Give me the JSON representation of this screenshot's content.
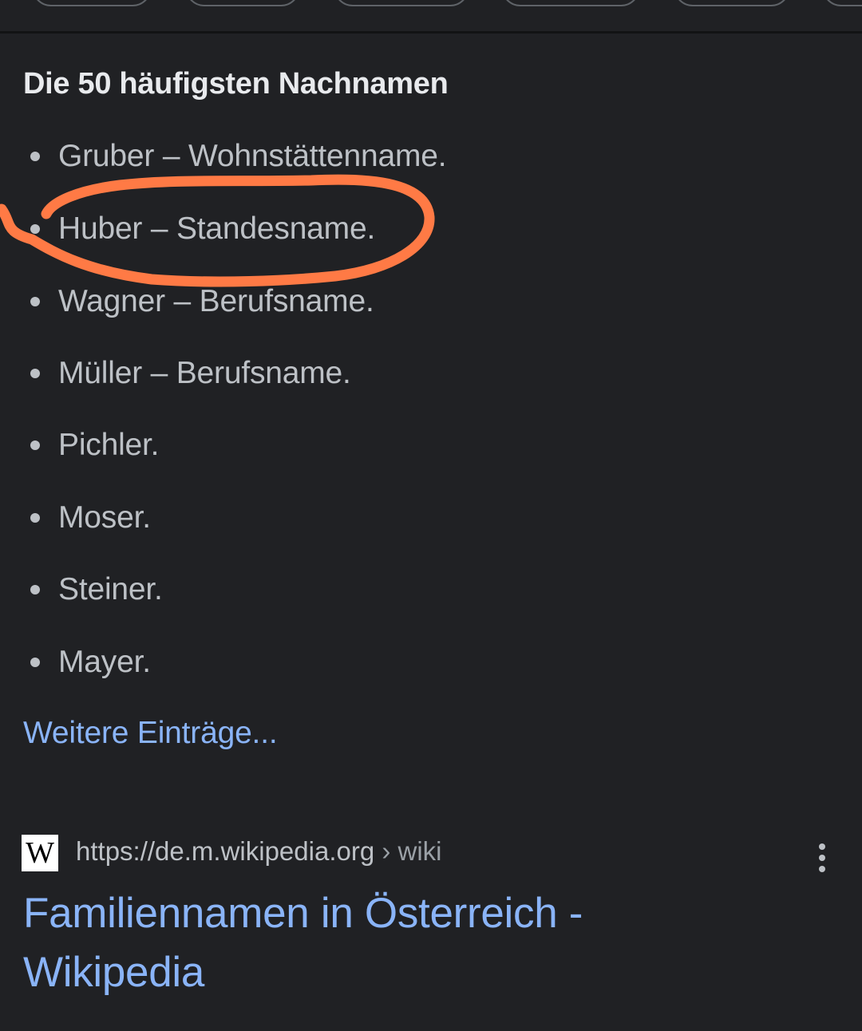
{
  "snippet": {
    "heading": "Die 50 häufigsten Nachnamen",
    "items": [
      {
        "text": "Gruber – Wohnstättenname."
      },
      {
        "text": "Huber – Standesname."
      },
      {
        "text": "Wagner – Berufsname."
      },
      {
        "text": "Müller – Berufsname."
      },
      {
        "text": "Pichler."
      },
      {
        "text": "Moser."
      },
      {
        "text": "Steiner."
      },
      {
        "text": "Mayer."
      }
    ],
    "more_link": "Weitere Einträge..."
  },
  "result": {
    "favicon_letter": "W",
    "url": "https://de.m.wikipedia.org",
    "breadcrumb": " › wiki",
    "title": "Familiennamen in Österreich - Wikipedia",
    "menu_icon": "more-vert-icon"
  },
  "annotation": {
    "shape": "hand-drawn circle",
    "color": "#ff7a45"
  },
  "colors": {
    "background": "#202124",
    "text": "#bdc1c6",
    "heading": "#e8eaed",
    "link": "#8ab4f8"
  }
}
